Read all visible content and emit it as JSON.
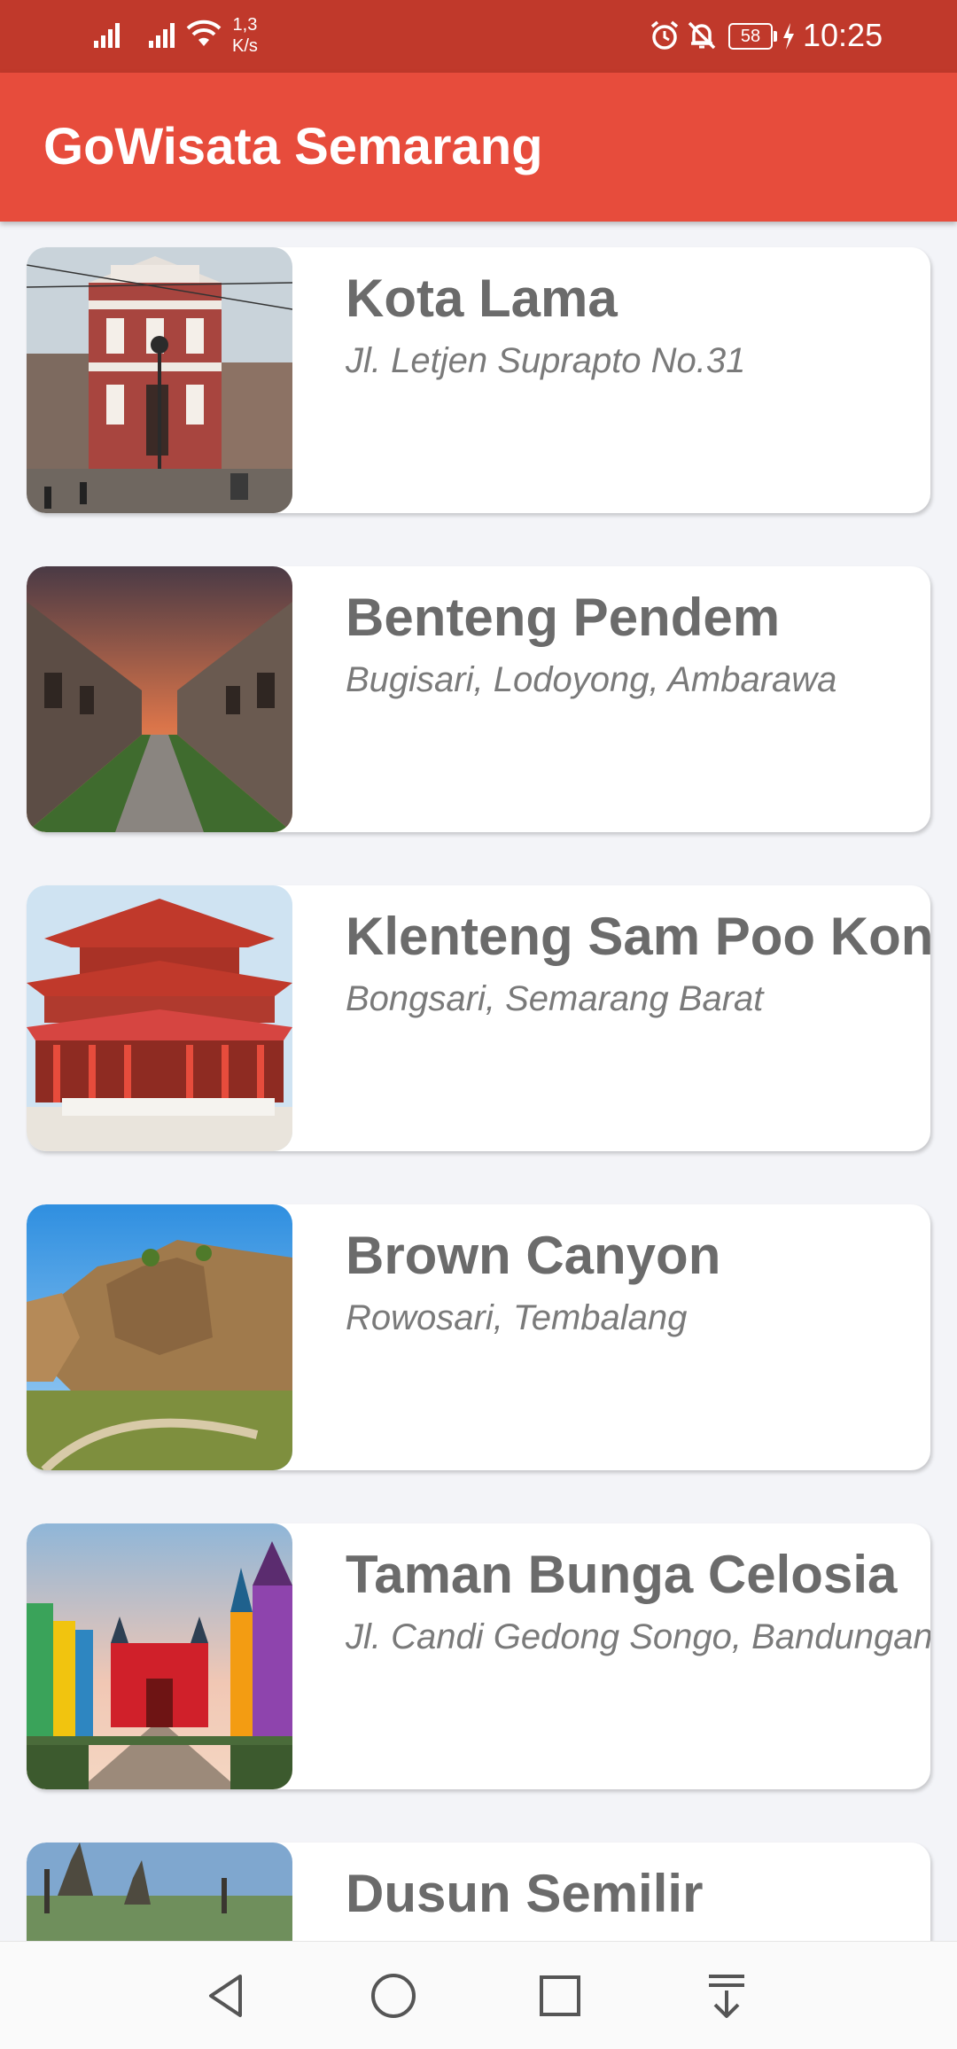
{
  "status_bar": {
    "speed_value": "1,3",
    "speed_unit": "K/s",
    "battery": "58",
    "time": "10:25",
    "icons": [
      "signal-icon",
      "signal-icon",
      "wifi-icon",
      "alarm-icon",
      "bell-off-icon",
      "battery-icon",
      "charging-icon"
    ]
  },
  "app_bar": {
    "title": "GoWisata Semarang"
  },
  "places": [
    {
      "name": "Kota Lama",
      "address": "Jl. Letjen Suprapto No.31"
    },
    {
      "name": "Benteng Pendem",
      "address": "Bugisari, Lodoyong, Ambarawa"
    },
    {
      "name": "Klenteng Sam Poo Kong",
      "address": "Bongsari, Semarang Barat"
    },
    {
      "name": "Brown Canyon",
      "address": "Rowosari, Tembalang"
    },
    {
      "name": "Taman Bunga Celosia",
      "address": "Jl. Candi Gedong Songo, Bandungan"
    },
    {
      "name": "Dusun Semilir",
      "address": ""
    }
  ],
  "nav_bar": {
    "icons": [
      "back-icon",
      "home-icon",
      "recents-icon",
      "notification-pull-icon"
    ]
  },
  "colors": {
    "status_bar": "#c0392b",
    "app_bar": "#e74c3c",
    "background": "#f3f4f8",
    "card": "#ffffff",
    "title_text": "#6b6b6b"
  }
}
